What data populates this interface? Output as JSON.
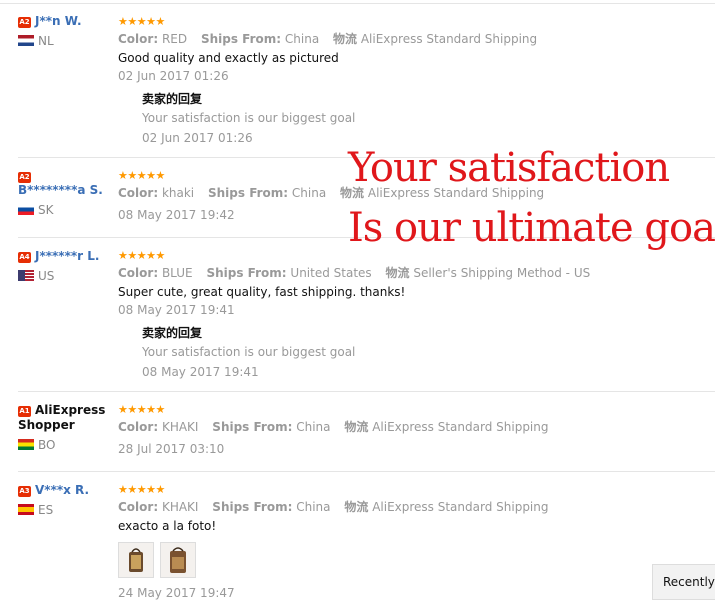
{
  "labels": {
    "color": "Color:",
    "ships_from": "Ships From:",
    "shipping": "物流"
  },
  "reviews": [
    {
      "level": "A2",
      "name": "J**n W.",
      "country": "NL",
      "stars": "★★★★★",
      "color": "RED",
      "ships_from": "China",
      "shipping": "AliExpress Standard Shipping",
      "text": "Good quality and exactly as pictured",
      "date": "02 Jun 2017 01:26",
      "reply": {
        "title": "卖家的回复",
        "text": "Your satisfaction is our biggest goal",
        "date": "02 Jun 2017 01:26"
      }
    },
    {
      "level": "A2",
      "name": "B********a S.",
      "country": "SK",
      "stars": "★★★★★",
      "color": "khaki",
      "ships_from": "China",
      "shipping": "AliExpress Standard Shipping",
      "date": "08 May 2017 19:42"
    },
    {
      "level": "A4",
      "name": "J******r L.",
      "country": "US",
      "stars": "★★★★★",
      "color": "BLUE",
      "ships_from": "United States",
      "shipping": "Seller's Shipping Method - US",
      "text": "Super cute, great quality, fast shipping. thanks!",
      "date": "08 May 2017 19:41",
      "reply": {
        "title": "卖家的回复",
        "text": "Your satisfaction is our biggest goal",
        "date": "08 May 2017 19:41"
      }
    },
    {
      "level": "A1",
      "name": "AliExpress Shopper",
      "country": "BO",
      "stars": "★★★★★",
      "color": "KHAKI",
      "ships_from": "China",
      "shipping": "AliExpress Standard Shipping",
      "date": "28 Jul 2017 03:10"
    },
    {
      "level": "A3",
      "name": "V***x R.",
      "country": "ES",
      "stars": "★★★★★",
      "color": "KHAKI",
      "ships_from": "China",
      "shipping": "AliExpress Standard Shipping",
      "text": "exacto a la foto!",
      "date": "24 May 2017 19:47"
    }
  ],
  "overlay": {
    "line1": "Your satisfaction",
    "line2": "Is our ultimate goal"
  },
  "recently_viewed": "Recently Viewed",
  "colors": {
    "level_badge": "#e62e04",
    "username": "#3a6eb5",
    "stars": "#ff9900",
    "overlay_text": "#e0171b"
  }
}
